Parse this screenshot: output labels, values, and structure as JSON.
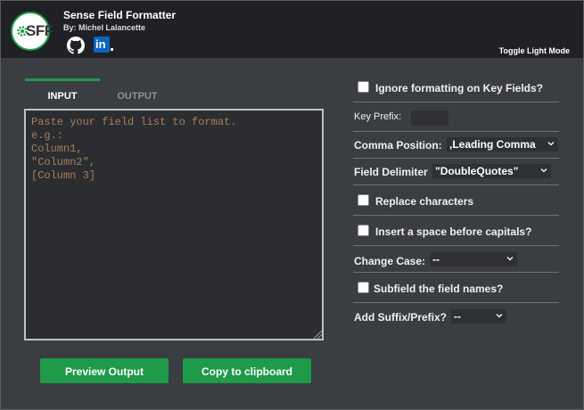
{
  "app": {
    "title": "Sense Field Formatter",
    "author": "By: Michel Lalancette",
    "logo_text": "SFF",
    "toggle_label": "Toggle Light Mode"
  },
  "colors": {
    "accent": "#1f9a48",
    "header_bg": "#1f2124",
    "body_bg": "#3a3d42",
    "placeholder": "#a67f5a"
  },
  "icons": {
    "github": "github-icon",
    "linkedin": "linkedin-icon",
    "gear": "gear-icon"
  },
  "tabs": [
    {
      "label": "INPUT",
      "active": true
    },
    {
      "label": "OUTPUT",
      "active": false
    }
  ],
  "input": {
    "placeholder": "Paste your field list to format.\ne.g.:\nColumn1,\n\"Column2\",\n[Column 3]"
  },
  "buttons": {
    "preview": "Preview Output",
    "copy": "Copy to clipboard"
  },
  "options": {
    "ignore_key_fields": {
      "label": "Ignore formatting on Key Fields?",
      "checked": false
    },
    "key_prefix": {
      "label": "Key Prefix:",
      "value": ""
    },
    "comma_position": {
      "label": "Comma Position:",
      "selected": ",Leading Comma"
    },
    "field_delimiter": {
      "label": "Field Delimiter",
      "selected": "\"DoubleQuotes\""
    },
    "replace_chars": {
      "label": "Replace characters",
      "checked": false
    },
    "space_before_capitals": {
      "label": "Insert a space before capitals?",
      "checked": false
    },
    "change_case": {
      "label": "Change Case:",
      "selected": "--"
    },
    "subfield": {
      "label": "Subfield the field names?",
      "checked": false
    },
    "suffix_prefix": {
      "label": "Add Suffix/Prefix?",
      "selected": "--"
    }
  }
}
